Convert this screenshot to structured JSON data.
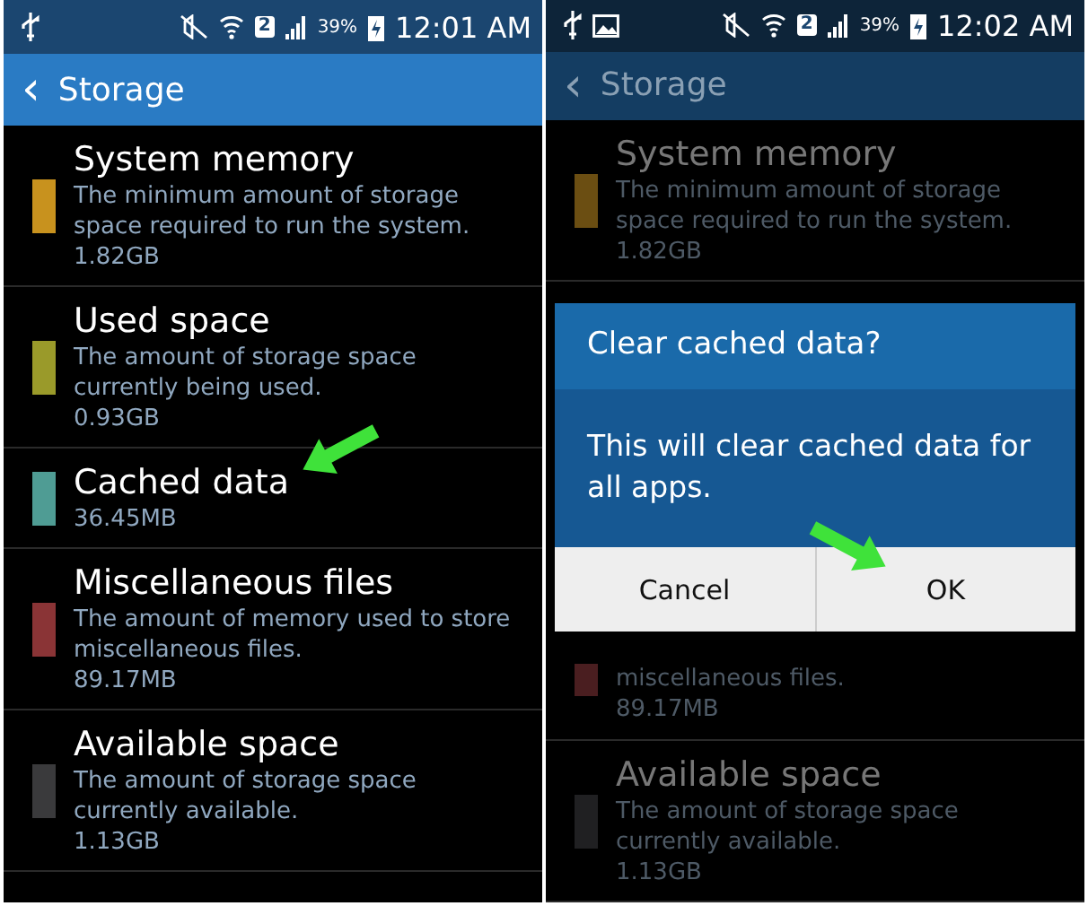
{
  "screens": [
    {
      "dimmed": false,
      "status_bar": {
        "show_gallery": false,
        "sim_badge": "2",
        "battery": "39%",
        "time": "12:01 AM"
      },
      "app_bar": {
        "back": "‹",
        "title": "Storage"
      },
      "items": [
        {
          "kind": "item",
          "title": "System memory",
          "description": "The minimum amount of storage space required to run the system.",
          "size": "1.82GB",
          "color": "#c8921e"
        },
        {
          "kind": "item",
          "title": "Used space",
          "description": "The amount of storage space currently being used.",
          "size": "0.93GB",
          "color": "#9a9a2a"
        },
        {
          "kind": "item",
          "title": "Cached data",
          "size": "36.45MB",
          "color": "#4f9c94"
        },
        {
          "kind": "item",
          "title": "Miscellaneous files",
          "description": "The amount of memory used to store miscellaneous files.",
          "size": "89.17MB",
          "color": "#8a3436"
        },
        {
          "kind": "item",
          "title": "Available space",
          "description": "The amount of storage space currently available.",
          "size": "1.13GB",
          "color": "#3a3a3c"
        }
      ]
    },
    {
      "dimmed": true,
      "status_bar": {
        "show_gallery": true,
        "sim_badge": "2",
        "battery": "39%",
        "time": "12:02 AM"
      },
      "app_bar": {
        "back": "‹",
        "title": "Storage"
      },
      "items": [
        {
          "kind": "item",
          "title": "System memory",
          "description": "The minimum amount of storage space required to run the system.",
          "size": "1.82GB",
          "color": "#6b4e12"
        },
        {
          "kind": "dialog",
          "title": "Clear cached data?",
          "message": "This will clear cached data for all apps.",
          "buttons": [
            "Cancel",
            "OK"
          ]
        },
        {
          "kind": "partial",
          "description": "miscellaneous files.",
          "size": "89.17MB",
          "color": "#4a1e20"
        },
        {
          "kind": "item",
          "title": "Available space",
          "description": "The amount of storage space currently available.",
          "size": "1.13GB",
          "color": "#202022"
        }
      ]
    }
  ]
}
